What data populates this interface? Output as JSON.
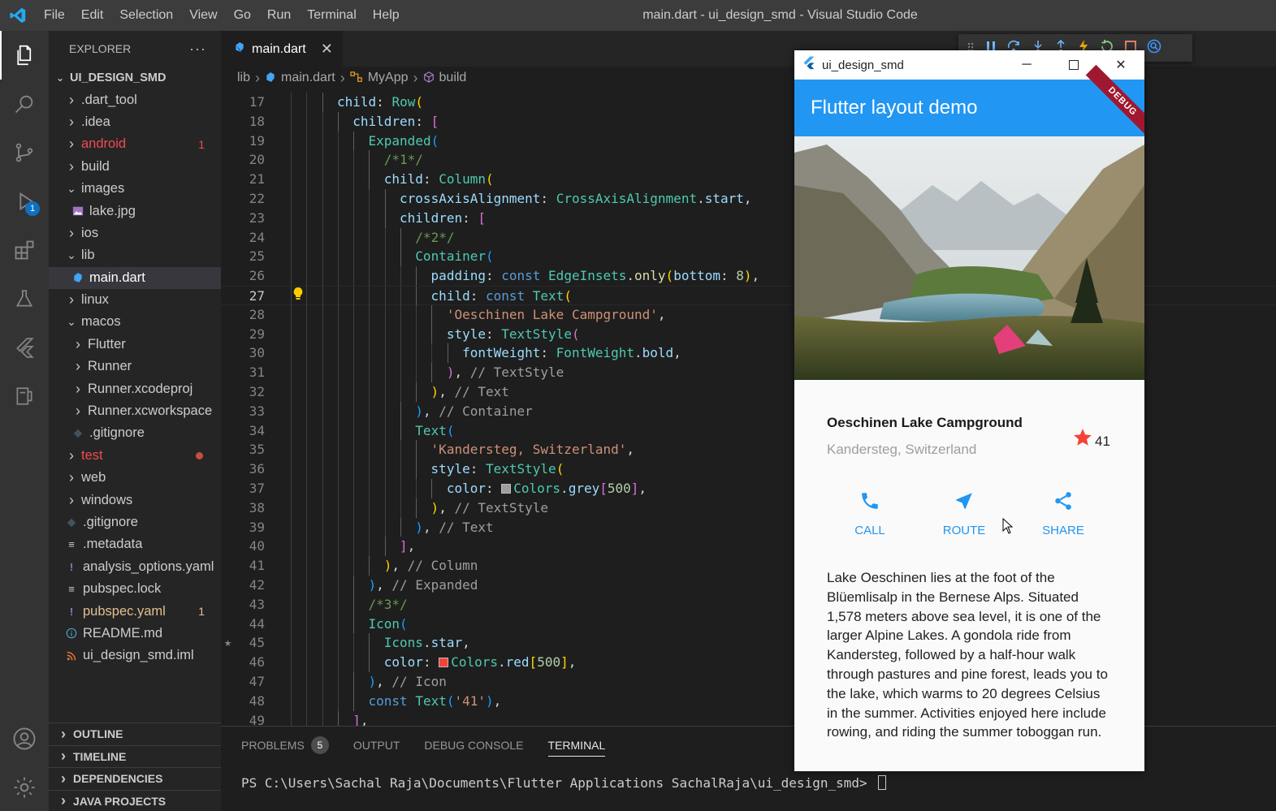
{
  "window": {
    "title": "main.dart - ui_design_smd - Visual Studio Code",
    "menu": [
      "File",
      "Edit",
      "Selection",
      "View",
      "Go",
      "Run",
      "Terminal",
      "Help"
    ]
  },
  "activity": {
    "debug_badge": "1"
  },
  "sidebar": {
    "header": "EXPLORER",
    "more": "···",
    "root": "UI_DESIGN_SMD",
    "items": [
      {
        "label": ".dart_tool",
        "kind": "folder",
        "depth": 1,
        "open": false,
        "color": "#cccccc"
      },
      {
        "label": ".idea",
        "kind": "folder",
        "depth": 1,
        "open": false,
        "color": "#cccccc"
      },
      {
        "label": "android",
        "kind": "folder",
        "depth": 1,
        "open": false,
        "color": "#f14c4c",
        "count": "1"
      },
      {
        "label": "build",
        "kind": "folder",
        "depth": 1,
        "open": false,
        "color": "#cccccc"
      },
      {
        "label": "images",
        "kind": "folder",
        "depth": 1,
        "open": true,
        "color": "#cccccc"
      },
      {
        "label": "lake.jpg",
        "kind": "image",
        "depth": 2,
        "color": "#cccccc"
      },
      {
        "label": "ios",
        "kind": "folder",
        "depth": 1,
        "open": false,
        "color": "#cccccc"
      },
      {
        "label": "lib",
        "kind": "folder",
        "depth": 1,
        "open": true,
        "color": "#cccccc"
      },
      {
        "label": "main.dart",
        "kind": "dart",
        "depth": 2,
        "color": "#ffffff",
        "selected": true
      },
      {
        "label": "linux",
        "kind": "folder",
        "depth": 1,
        "open": false,
        "color": "#cccccc"
      },
      {
        "label": "macos",
        "kind": "folder",
        "depth": 1,
        "open": true,
        "color": "#cccccc"
      },
      {
        "label": "Flutter",
        "kind": "folder",
        "depth": 2,
        "open": false,
        "color": "#cccccc"
      },
      {
        "label": "Runner",
        "kind": "folder",
        "depth": 2,
        "open": false,
        "color": "#cccccc"
      },
      {
        "label": "Runner.xcodeproj",
        "kind": "folder",
        "depth": 2,
        "open": false,
        "color": "#cccccc"
      },
      {
        "label": "Runner.xcworkspace",
        "kind": "folder",
        "depth": 2,
        "open": false,
        "color": "#cccccc"
      },
      {
        "label": ".gitignore",
        "kind": "git",
        "depth": 2,
        "color": "#cccccc"
      },
      {
        "label": "test",
        "kind": "folder",
        "depth": 1,
        "open": false,
        "color": "#f14c4c",
        "dot": true
      },
      {
        "label": "web",
        "kind": "folder",
        "depth": 1,
        "open": false,
        "color": "#cccccc"
      },
      {
        "label": "windows",
        "kind": "folder",
        "depth": 1,
        "open": false,
        "color": "#cccccc"
      },
      {
        "label": ".gitignore",
        "kind": "git",
        "depth": 1,
        "color": "#cccccc"
      },
      {
        "label": ".metadata",
        "kind": "lines",
        "depth": 1,
        "color": "#cccccc"
      },
      {
        "label": "analysis_options.yaml",
        "kind": "yaml",
        "depth": 1,
        "color": "#cccccc"
      },
      {
        "label": "pubspec.lock",
        "kind": "lines",
        "depth": 1,
        "color": "#cccccc"
      },
      {
        "label": "pubspec.yaml",
        "kind": "yaml",
        "depth": 1,
        "color": "#e2c08d",
        "count": "1"
      },
      {
        "label": "README.md",
        "kind": "info",
        "depth": 1,
        "color": "#cccccc"
      },
      {
        "label": "ui_design_smd.iml",
        "kind": "rss",
        "depth": 1,
        "color": "#cccccc"
      }
    ],
    "sections": [
      "OUTLINE",
      "TIMELINE",
      "DEPENDENCIES",
      "JAVA PROJECTS"
    ]
  },
  "editor": {
    "tab_label": "main.dart",
    "breadcrumb": [
      "lib",
      "main.dart",
      "MyApp",
      "build"
    ],
    "current_line": 27,
    "lines": [
      {
        "n": 17,
        "html": "<span class='t-def'>child</span><span class='t-pun'>: </span><span class='t-fn'>Row</span><span class='t-y'>(</span>",
        "indent": 3
      },
      {
        "n": 18,
        "html": "<span class='t-def'>children</span><span class='t-pun'>: </span><span class='t-p'>[</span>",
        "indent": 4
      },
      {
        "n": 19,
        "html": "<span class='t-fn'>Expanded</span><span class='t-b'>(</span>",
        "indent": 5
      },
      {
        "n": 20,
        "html": "<span class='t-com'>/*1*/</span>",
        "indent": 6
      },
      {
        "n": 21,
        "html": "<span class='t-def'>child</span><span class='t-pun'>: </span><span class='t-fn'>Column</span><span class='t-y'>(</span>",
        "indent": 6
      },
      {
        "n": 22,
        "html": "<span class='t-def'>crossAxisAlignment</span><span class='t-pun'>: </span><span class='t-fn'>CrossAxisAlignment</span><span class='t-pun'>.</span><span class='t-def'>start</span><span class='t-pun'>,</span>",
        "indent": 7
      },
      {
        "n": 23,
        "html": "<span class='t-def'>children</span><span class='t-pun'>: </span><span class='t-p'>[</span>",
        "indent": 7
      },
      {
        "n": 24,
        "html": "<span class='t-com'>/*2*/</span>",
        "indent": 8
      },
      {
        "n": 25,
        "html": "<span class='t-fn'>Container</span><span class='t-b'>(</span>",
        "indent": 8
      },
      {
        "n": 26,
        "html": "<span class='t-def'>padding</span><span class='t-pun'>: </span><span class='t-kw'>const </span><span class='t-fn'>EdgeInsets</span><span class='t-pun'>.</span><span style='color:#dcdcaa'>only</span><span class='t-y'>(</span><span class='t-def'>bottom</span><span class='t-pun'>: </span><span class='t-num'>8</span><span class='t-y'>)</span><span class='t-pun'>,</span>",
        "indent": 9
      },
      {
        "n": 27,
        "html": "<span class='t-def'>child</span><span class='t-pun'>: </span><span class='t-kw'>const </span><span class='t-fn'>Text</span><span class='t-y'>(</span>",
        "indent": 9
      },
      {
        "n": 28,
        "html": "<span class='t-str'>'Oeschinen Lake Campground'</span><span class='t-pun'>,</span>",
        "indent": 10
      },
      {
        "n": 29,
        "html": "<span class='t-def'>style</span><span class='t-pun'>: </span><span class='t-fn'>TextStyle</span><span class='t-p'>(</span>",
        "indent": 10
      },
      {
        "n": 30,
        "html": "<span class='t-def'>fontWeight</span><span class='t-pun'>: </span><span class='t-fn'>FontWeight</span><span class='t-pun'>.</span><span class='t-def'>bold</span><span class='t-pun'>,</span>",
        "indent": 11
      },
      {
        "n": 31,
        "html": "<span class='t-p'>)</span><span class='t-pun'>, </span><span class='t-gray'>// TextStyle</span>",
        "indent": 10
      },
      {
        "n": 32,
        "html": "<span class='t-y'>)</span><span class='t-pun'>, </span><span class='t-gray'>// Text</span>",
        "indent": 9
      },
      {
        "n": 33,
        "html": "<span class='t-b'>)</span><span class='t-pun'>, </span><span class='t-gray'>// Container</span>",
        "indent": 8
      },
      {
        "n": 34,
        "html": "<span class='t-fn'>Text</span><span class='t-b'>(</span>",
        "indent": 8
      },
      {
        "n": 35,
        "html": "<span class='t-str'>'Kandersteg, Switzerland'</span><span class='t-pun'>,</span>",
        "indent": 9
      },
      {
        "n": 36,
        "html": "<span class='t-def'>style</span><span class='t-pun'>: </span><span class='t-fn'>TextStyle</span><span class='t-y'>(</span>",
        "indent": 9
      },
      {
        "n": 37,
        "html": "<span class='t-def'>color</span><span class='t-pun'>: </span><span class='swatch' style='background:#9e9e9e'></span><span class='t-fn'>Colors</span><span class='t-pun'>.</span><span class='t-def'>grey</span><span class='t-p'>[</span><span class='t-num'>500</span><span class='t-p'>]</span><span class='t-pun'>,</span>",
        "indent": 10
      },
      {
        "n": 38,
        "html": "<span class='t-y'>)</span><span class='t-pun'>, </span><span class='t-gray'>// TextStyle</span>",
        "indent": 9
      },
      {
        "n": 39,
        "html": "<span class='t-b'>)</span><span class='t-pun'>, </span><span class='t-gray'>// Text</span>",
        "indent": 8
      },
      {
        "n": 40,
        "html": "<span class='t-p'>]</span><span class='t-pun'>,</span>",
        "indent": 7
      },
      {
        "n": 41,
        "html": "<span class='t-y'>)</span><span class='t-pun'>, </span><span class='t-gray'>// Column</span>",
        "indent": 6
      },
      {
        "n": 42,
        "html": "<span class='t-b'>)</span><span class='t-pun'>, </span><span class='t-gray'>// Expanded</span>",
        "indent": 5
      },
      {
        "n": 43,
        "html": "<span class='t-com'>/*3*/</span>",
        "indent": 5
      },
      {
        "n": 44,
        "html": "<span class='t-fn'>Icon</span><span class='t-b'>(</span>",
        "indent": 5
      },
      {
        "n": 45,
        "html": "<span class='t-fn'>Icons</span><span class='t-pun'>.</span><span class='t-def'>star</span><span class='t-pun'>,</span>",
        "indent": 6
      },
      {
        "n": 46,
        "html": "<span class='t-def'>color</span><span class='t-pun'>: </span><span class='swatch' style='background:#f44336'></span><span class='t-fn'>Colors</span><span class='t-pun'>.</span><span class='t-def'>red</span><span class='t-y'>[</span><span class='t-num'>500</span><span class='t-y'>]</span><span class='t-pun'>,</span>",
        "indent": 6
      },
      {
        "n": 47,
        "html": "<span class='t-b'>)</span><span class='t-pun'>, </span><span class='t-gray'>// Icon</span>",
        "indent": 5
      },
      {
        "n": 48,
        "html": "<span class='t-kw'>const </span><span class='t-fn'>Text</span><span class='t-b'>(</span><span class='t-str'>'41'</span><span class='t-b'>)</span><span class='t-pun'>,</span>",
        "indent": 5
      },
      {
        "n": 49,
        "html": "<span class='t-p'>]</span><span class='t-pun'>,</span>",
        "indent": 4
      }
    ]
  },
  "panel": {
    "tabs": [
      "PROBLEMS",
      "OUTPUT",
      "DEBUG CONSOLE",
      "TERMINAL"
    ],
    "problems_count": "5",
    "active_tab": "TERMINAL",
    "terminal_prompt": "PS C:\\Users\\Sachal Raja\\Documents\\Flutter Applications SachalRaja\\ui_design_smd> "
  },
  "app": {
    "window_title": "ui_design_smd",
    "appbar_title": "Flutter layout demo",
    "debug_banner": "DEBUG",
    "place_title": "Oeschinen Lake Campground",
    "place_subtitle": "Kandersteg, Switzerland",
    "star_count": "41",
    "colors": {
      "primary": "#2196f3",
      "star": "#f44336"
    },
    "buttons": [
      {
        "label": "CALL",
        "icon": "phone-icon"
      },
      {
        "label": "ROUTE",
        "icon": "near-me-icon"
      },
      {
        "label": "SHARE",
        "icon": "share-icon"
      }
    ],
    "description": "Lake Oeschinen lies at the foot of the Blüemlisalp in the Bernese Alps. Situated 1,578 meters above sea level, it is one of the larger Alpine Lakes. A gondola ride from Kandersteg, followed by a half-hour walk through pastures and pine forest, leads you to the lake, which warms to 20 degrees Celsius in the summer. Activities enjoyed here include rowing, and riding the summer toboggan run."
  }
}
